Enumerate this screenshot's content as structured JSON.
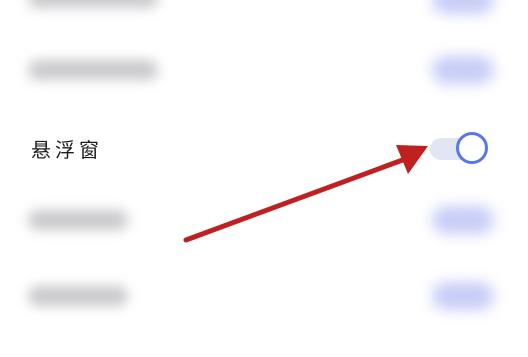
{
  "settings_row": {
    "label": "悬浮窗",
    "toggle_state": "on"
  },
  "annotation": {
    "type": "arrow",
    "color": "#c0201f"
  },
  "colors": {
    "toggle_accent": "#5878e8",
    "toggle_track": "#e1e5f4"
  }
}
